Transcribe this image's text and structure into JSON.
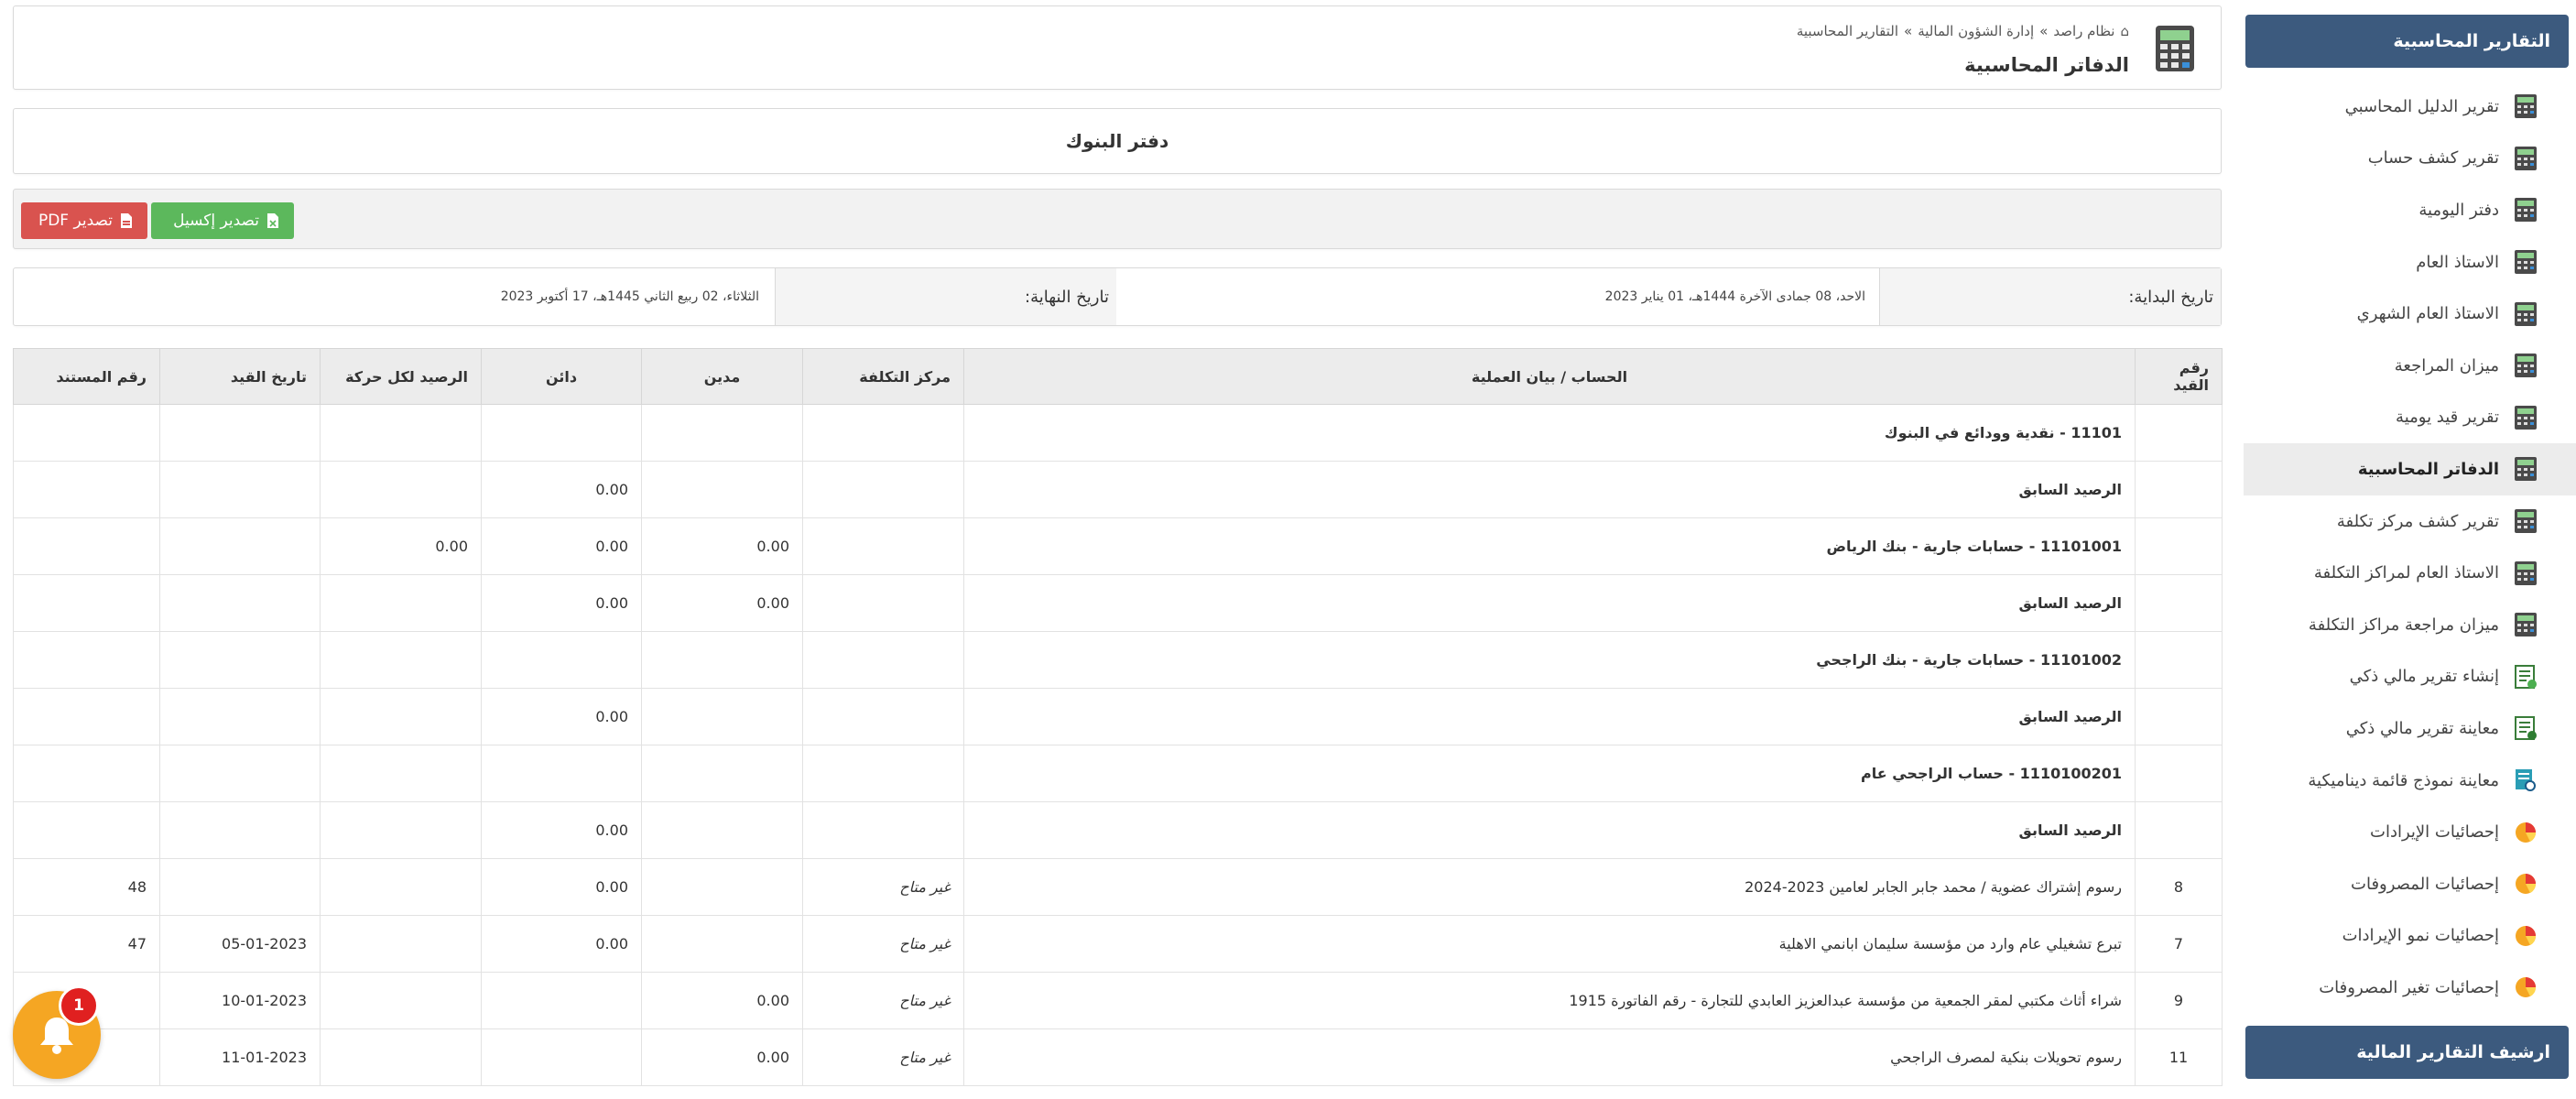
{
  "breadcrumb": {
    "home": "نظام راصد",
    "section": "إدارة الشؤون المالية",
    "current": "التقارير المحاسبية",
    "separator": "»"
  },
  "page": {
    "title": "الدفاتر المحاسبية",
    "book_title": "دفتر البنوك"
  },
  "toolbar": {
    "excel_label": "تصدير إكسيل",
    "pdf_label": "تصدير PDF"
  },
  "dates": {
    "start_label": "تاريخ البداية:",
    "start_value": "الاحد، 08 جمادى الآخرة 1444هـ، 01 يناير 2023",
    "end_label": "تاريخ النهاية:",
    "end_value": "الثلاثاء، 02 ربيع الثاني 1445هـ، 17 أكتوبر 2023"
  },
  "sidebar": {
    "header": "التقارير المحاسبية",
    "footer": "ارشيف التقارير المالية",
    "items": [
      {
        "label": "تقرير الدليل المحاسبي",
        "icon": "calculator-icon"
      },
      {
        "label": "تقرير كشف حساب",
        "icon": "calculator-icon"
      },
      {
        "label": "دفتر اليومية",
        "icon": "calculator-icon"
      },
      {
        "label": "الاستاذ العام",
        "icon": "calculator-icon"
      },
      {
        "label": "الاستاذ العام الشهري",
        "icon": "calculator-icon"
      },
      {
        "label": "ميزان المراجعة",
        "icon": "calculator-icon"
      },
      {
        "label": "تقرير قيد يومية",
        "icon": "calculator-icon"
      },
      {
        "label": "الدفاتر المحاسبية",
        "icon": "calculator-icon",
        "active": true
      },
      {
        "label": "تقرير كشف مركز تكلفة",
        "icon": "calculator-icon"
      },
      {
        "label": "الاستاذ العام لمراكز التكلفة",
        "icon": "calculator-icon"
      },
      {
        "label": "ميزان مراجعة مراكز التكلفة",
        "icon": "calculator-icon"
      },
      {
        "label": "إنشاء تقرير مالي ذكي",
        "icon": "spreadsheet-add-icon"
      },
      {
        "label": "معاينة تقرير مالي ذكي",
        "icon": "spreadsheet-view-icon"
      },
      {
        "label": "معاينة نموذج قائمة ديناميكية",
        "icon": "search-report-icon"
      },
      {
        "label": "إحصائيات الإيرادات",
        "icon": "pie-chart-icon"
      },
      {
        "label": "إحصائيات المصروفات",
        "icon": "pie-chart-icon"
      },
      {
        "label": "إحصائيات نمو الإيرادات",
        "icon": "pie-chart-icon"
      },
      {
        "label": "إحصائيات تغير المصروفات",
        "icon": "pie-chart-icon"
      }
    ]
  },
  "table": {
    "headers": [
      "رقم القيد",
      "الحساب / بيان العملية",
      "مركز التكلفة",
      "مدين",
      "دائن",
      "الرصيد لكل حركة",
      "تاريخ القيد",
      "رقم المستند"
    ],
    "rows": [
      {
        "type": "account",
        "entry": "",
        "desc": "11101 - نقدية وودائع في البنوك",
        "cost": "",
        "debit": "",
        "credit": "",
        "balance": "",
        "date": "",
        "doc": ""
      },
      {
        "type": "prev",
        "entry": "",
        "desc": "الرصيد السابق",
        "cost": "",
        "debit": "",
        "credit": "0.00",
        "balance": "",
        "date": "",
        "doc": ""
      },
      {
        "type": "account",
        "entry": "",
        "desc": "11101001 - حسابات جارية - بنك الرياض",
        "cost": "",
        "debit": "0.00",
        "credit": "0.00",
        "balance": "0.00",
        "date": "",
        "doc": ""
      },
      {
        "type": "prev",
        "entry": "",
        "desc": "الرصيد السابق",
        "cost": "",
        "debit": "0.00",
        "credit": "0.00",
        "balance": "",
        "date": "",
        "doc": ""
      },
      {
        "type": "account",
        "entry": "",
        "desc": "11101002 - حسابات جارية - بنك الراجحي",
        "cost": "",
        "debit": "",
        "credit": "",
        "balance": "",
        "date": "",
        "doc": ""
      },
      {
        "type": "prev",
        "entry": "",
        "desc": "الرصيد السابق",
        "cost": "",
        "debit": "",
        "credit": "0.00",
        "balance": "",
        "date": "",
        "doc": ""
      },
      {
        "type": "account",
        "entry": "",
        "desc": "1110100201 - حساب الراجحي عام",
        "cost": "",
        "debit": "",
        "credit": "",
        "balance": "",
        "date": "",
        "doc": ""
      },
      {
        "type": "prev",
        "entry": "",
        "desc": "الرصيد السابق",
        "cost": "",
        "debit": "",
        "credit": "0.00",
        "balance": "",
        "date": "",
        "doc": ""
      },
      {
        "type": "tx",
        "entry": "8",
        "desc": "رسوم إشتراك عضوية / محمد جابر الجابر لعامين 2023-2024",
        "cost": "غير متاح",
        "debit": "",
        "credit": "0.00",
        "balance": "",
        "date": "",
        "doc": "48"
      },
      {
        "type": "tx",
        "entry": "7",
        "desc": "تبرع تشغيلي عام وارد من مؤسسة سليمان ابانمي الاهلية",
        "cost": "غير متاح",
        "debit": "",
        "credit": "0.00",
        "balance": "",
        "date": "05-01-2023",
        "doc": "47"
      },
      {
        "type": "tx",
        "entry": "9",
        "desc": "شراء أثاث مكتبي لمقر الجمعية من مؤسسة عبدالعزيز العابدي للتجارة - رقم الفاتورة 1915",
        "cost": "غير متاح",
        "debit": "0.00",
        "credit": "",
        "balance": "",
        "date": "10-01-2023",
        "doc": ""
      },
      {
        "type": "tx",
        "entry": "11",
        "desc": "رسوم تحويلات بنكية لمصرف الراجحي",
        "cost": "غير متاح",
        "debit": "0.00",
        "credit": "",
        "balance": "",
        "date": "11-01-2023",
        "doc": ""
      }
    ]
  },
  "notifications": {
    "count": "1",
    "icon": "bell-icon"
  },
  "colors": {
    "sidebar_header": "#3c5a7e",
    "excel_button": "#5cb85c",
    "pdf_button": "#d9534f",
    "account_text": "#d02323",
    "notification": "#f5a623"
  }
}
